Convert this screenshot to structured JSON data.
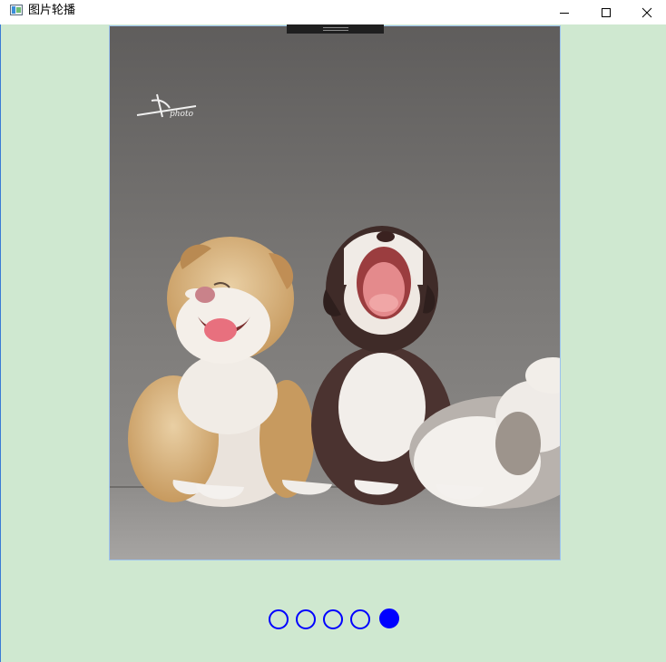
{
  "window": {
    "title": "图片轮播",
    "controls": [
      "minimize",
      "maximize",
      "close"
    ]
  },
  "slideshow": {
    "image_description_icon": "puppies-photo",
    "watermark_text": "photo",
    "slide_count": 5,
    "active_index": 4,
    "indicator_color": "#0000ff",
    "background_color": "#cfe8d0"
  }
}
